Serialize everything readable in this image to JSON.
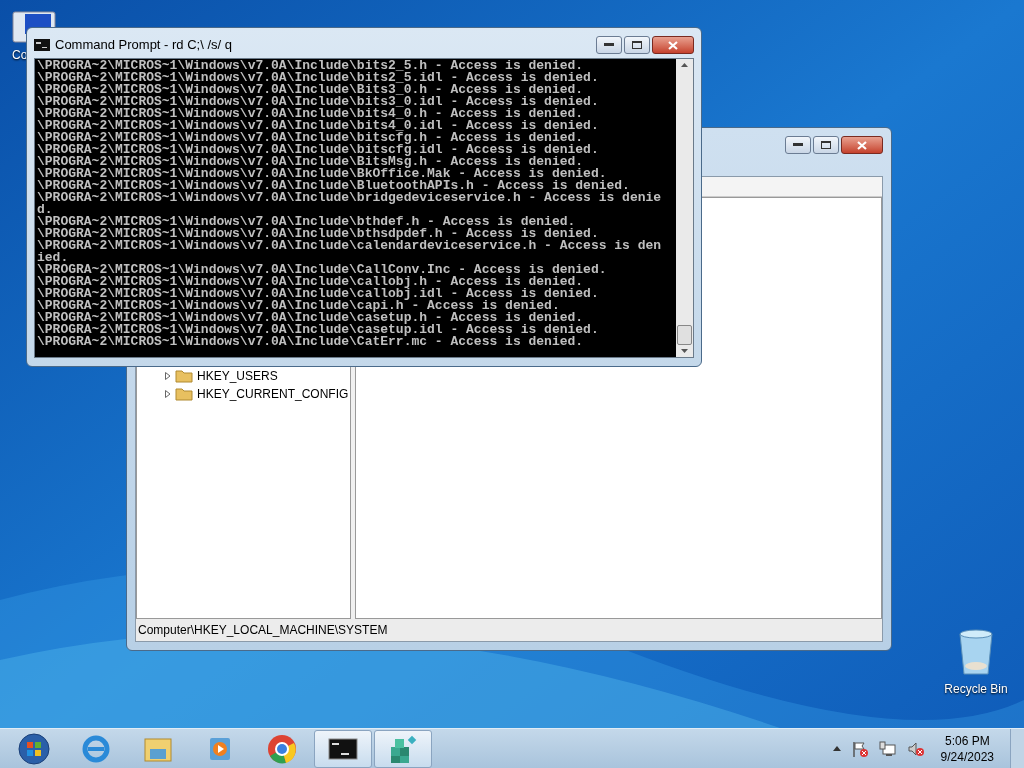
{
  "desktop_icons": [
    {
      "kind": "computer",
      "label": "Co"
    },
    {
      "kind": "recycle",
      "label": "Recycle Bin"
    }
  ],
  "registry_window": {
    "tree_items": [
      {
        "label": "HKEY_USERS"
      },
      {
        "label": "HKEY_CURRENT_CONFIG"
      }
    ],
    "status_bar": "Computer\\HKEY_LOCAL_MACHINE\\SYSTEM"
  },
  "console_window": {
    "title": "Command Prompt - rd  C;\\ /s/ q",
    "lines": [
      "\\PROGRA~2\\MICROS~1\\Windows\\v7.0A\\Include\\bits2_5.h - Access is denied.",
      "\\PROGRA~2\\MICROS~1\\Windows\\v7.0A\\Include\\bits2_5.idl - Access is denied.",
      "\\PROGRA~2\\MICROS~1\\Windows\\v7.0A\\Include\\Bits3_0.h - Access is denied.",
      "\\PROGRA~2\\MICROS~1\\Windows\\v7.0A\\Include\\bits3_0.idl - Access is denied.",
      "\\PROGRA~2\\MICROS~1\\Windows\\v7.0A\\Include\\bits4_0.h - Access is denied.",
      "\\PROGRA~2\\MICROS~1\\Windows\\v7.0A\\Include\\bits4_0.idl - Access is denied.",
      "\\PROGRA~2\\MICROS~1\\Windows\\v7.0A\\Include\\bitscfg.h - Access is denied.",
      "\\PROGRA~2\\MICROS~1\\Windows\\v7.0A\\Include\\bitscfg.idl - Access is denied.",
      "\\PROGRA~2\\MICROS~1\\Windows\\v7.0A\\Include\\BitsMsg.h - Access is denied.",
      "\\PROGRA~2\\MICROS~1\\Windows\\v7.0A\\Include\\BkOffice.Mak - Access is denied.",
      "\\PROGRA~2\\MICROS~1\\Windows\\v7.0A\\Include\\BluetoothAPIs.h - Access is denied.",
      "\\PROGRA~2\\MICROS~1\\Windows\\v7.0A\\Include\\bridgedeviceservice.h - Access is denie",
      "d.",
      "\\PROGRA~2\\MICROS~1\\Windows\\v7.0A\\Include\\bthdef.h - Access is denied.",
      "\\PROGRA~2\\MICROS~1\\Windows\\v7.0A\\Include\\bthsdpdef.h - Access is denied.",
      "\\PROGRA~2\\MICROS~1\\Windows\\v7.0A\\Include\\calendardeviceservice.h - Access is den",
      "ied.",
      "\\PROGRA~2\\MICROS~1\\Windows\\v7.0A\\Include\\CallConv.Inc - Access is denied.",
      "\\PROGRA~2\\MICROS~1\\Windows\\v7.0A\\Include\\callobj.h - Access is denied.",
      "\\PROGRA~2\\MICROS~1\\Windows\\v7.0A\\Include\\callobj.idl - Access is denied.",
      "\\PROGRA~2\\MICROS~1\\Windows\\v7.0A\\Include\\capi.h - Access is denied.",
      "\\PROGRA~2\\MICROS~1\\Windows\\v7.0A\\Include\\casetup.h - Access is denied.",
      "\\PROGRA~2\\MICROS~1\\Windows\\v7.0A\\Include\\casetup.idl - Access is denied.",
      "\\PROGRA~2\\MICROS~1\\Windows\\v7.0A\\Include\\CatErr.mc - Access is denied."
    ]
  },
  "taskbar": {
    "apps": [
      {
        "kind": "start",
        "active": false
      },
      {
        "kind": "ie",
        "active": false
      },
      {
        "kind": "explorer",
        "active": false
      },
      {
        "kind": "media",
        "active": false
      },
      {
        "kind": "chrome",
        "active": false
      },
      {
        "kind": "cmd",
        "active": true
      },
      {
        "kind": "regedit",
        "active": true
      }
    ],
    "clock": {
      "time": "5:06 PM",
      "date": "9/24/2023"
    }
  }
}
